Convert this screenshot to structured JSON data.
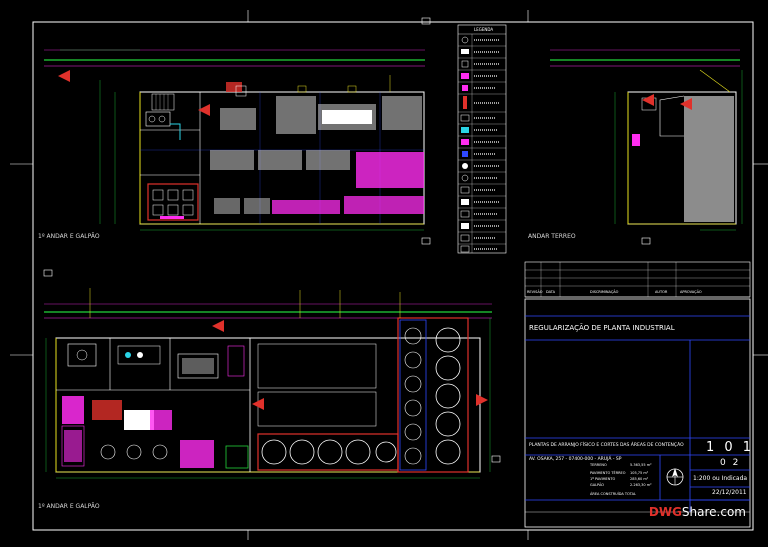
{
  "views": {
    "upper_left_title": "1º ANDAR E GALPÃO",
    "upper_right_title": "ANDAR TERREO",
    "lower_left_title": "1º ANDAR E GALPÃO"
  },
  "legend": {
    "title": "LEGENDA"
  },
  "revision_table": {
    "headers": [
      "REVISÃO",
      "DATA",
      "DISCRIMINAÇÃO",
      "AUTOR",
      "APROVAÇÃO"
    ]
  },
  "title_block": {
    "project_title": "REGULARIZAÇÃO DE PLANTA INDUSTRIAL",
    "drawing_description": "PLANTAS DE ARRANJO FÍSICO E CORTES DAS ÁREAS DE CONTENÇÃO",
    "address": "AV. OSAKA, 257 - 07400-000 - ARUJÁ - SP",
    "sheet_number": "1 0 1",
    "sheet_index": "0 2",
    "scale": "1:200 ou Indicada",
    "date": "22/12/2011",
    "areas": [
      {
        "label": "TERRENO",
        "value": "5.363,55 m²"
      },
      {
        "label": "PAVIMENTO TÉRREO",
        "value": "105,75 m²"
      },
      {
        "label": "1º PAVIMENTO",
        "value": "285,60 m²"
      },
      {
        "label": "GALPÃO",
        "value": "2.263,30 m²"
      },
      {
        "label": "ÁREA CONSTRUÍDA TOTAL",
        "value": ""
      }
    ]
  },
  "watermark": {
    "part_a": "DWG",
    "part_b": "Share.com"
  },
  "colors": {
    "background": "#000000",
    "wall": "#ffffff",
    "magenta": "#ff2df0",
    "blue": "#2f49ff",
    "yellow": "#e8e21e",
    "green": "#22d23a",
    "red": "#e0312b",
    "cyan": "#2ad4e6"
  }
}
